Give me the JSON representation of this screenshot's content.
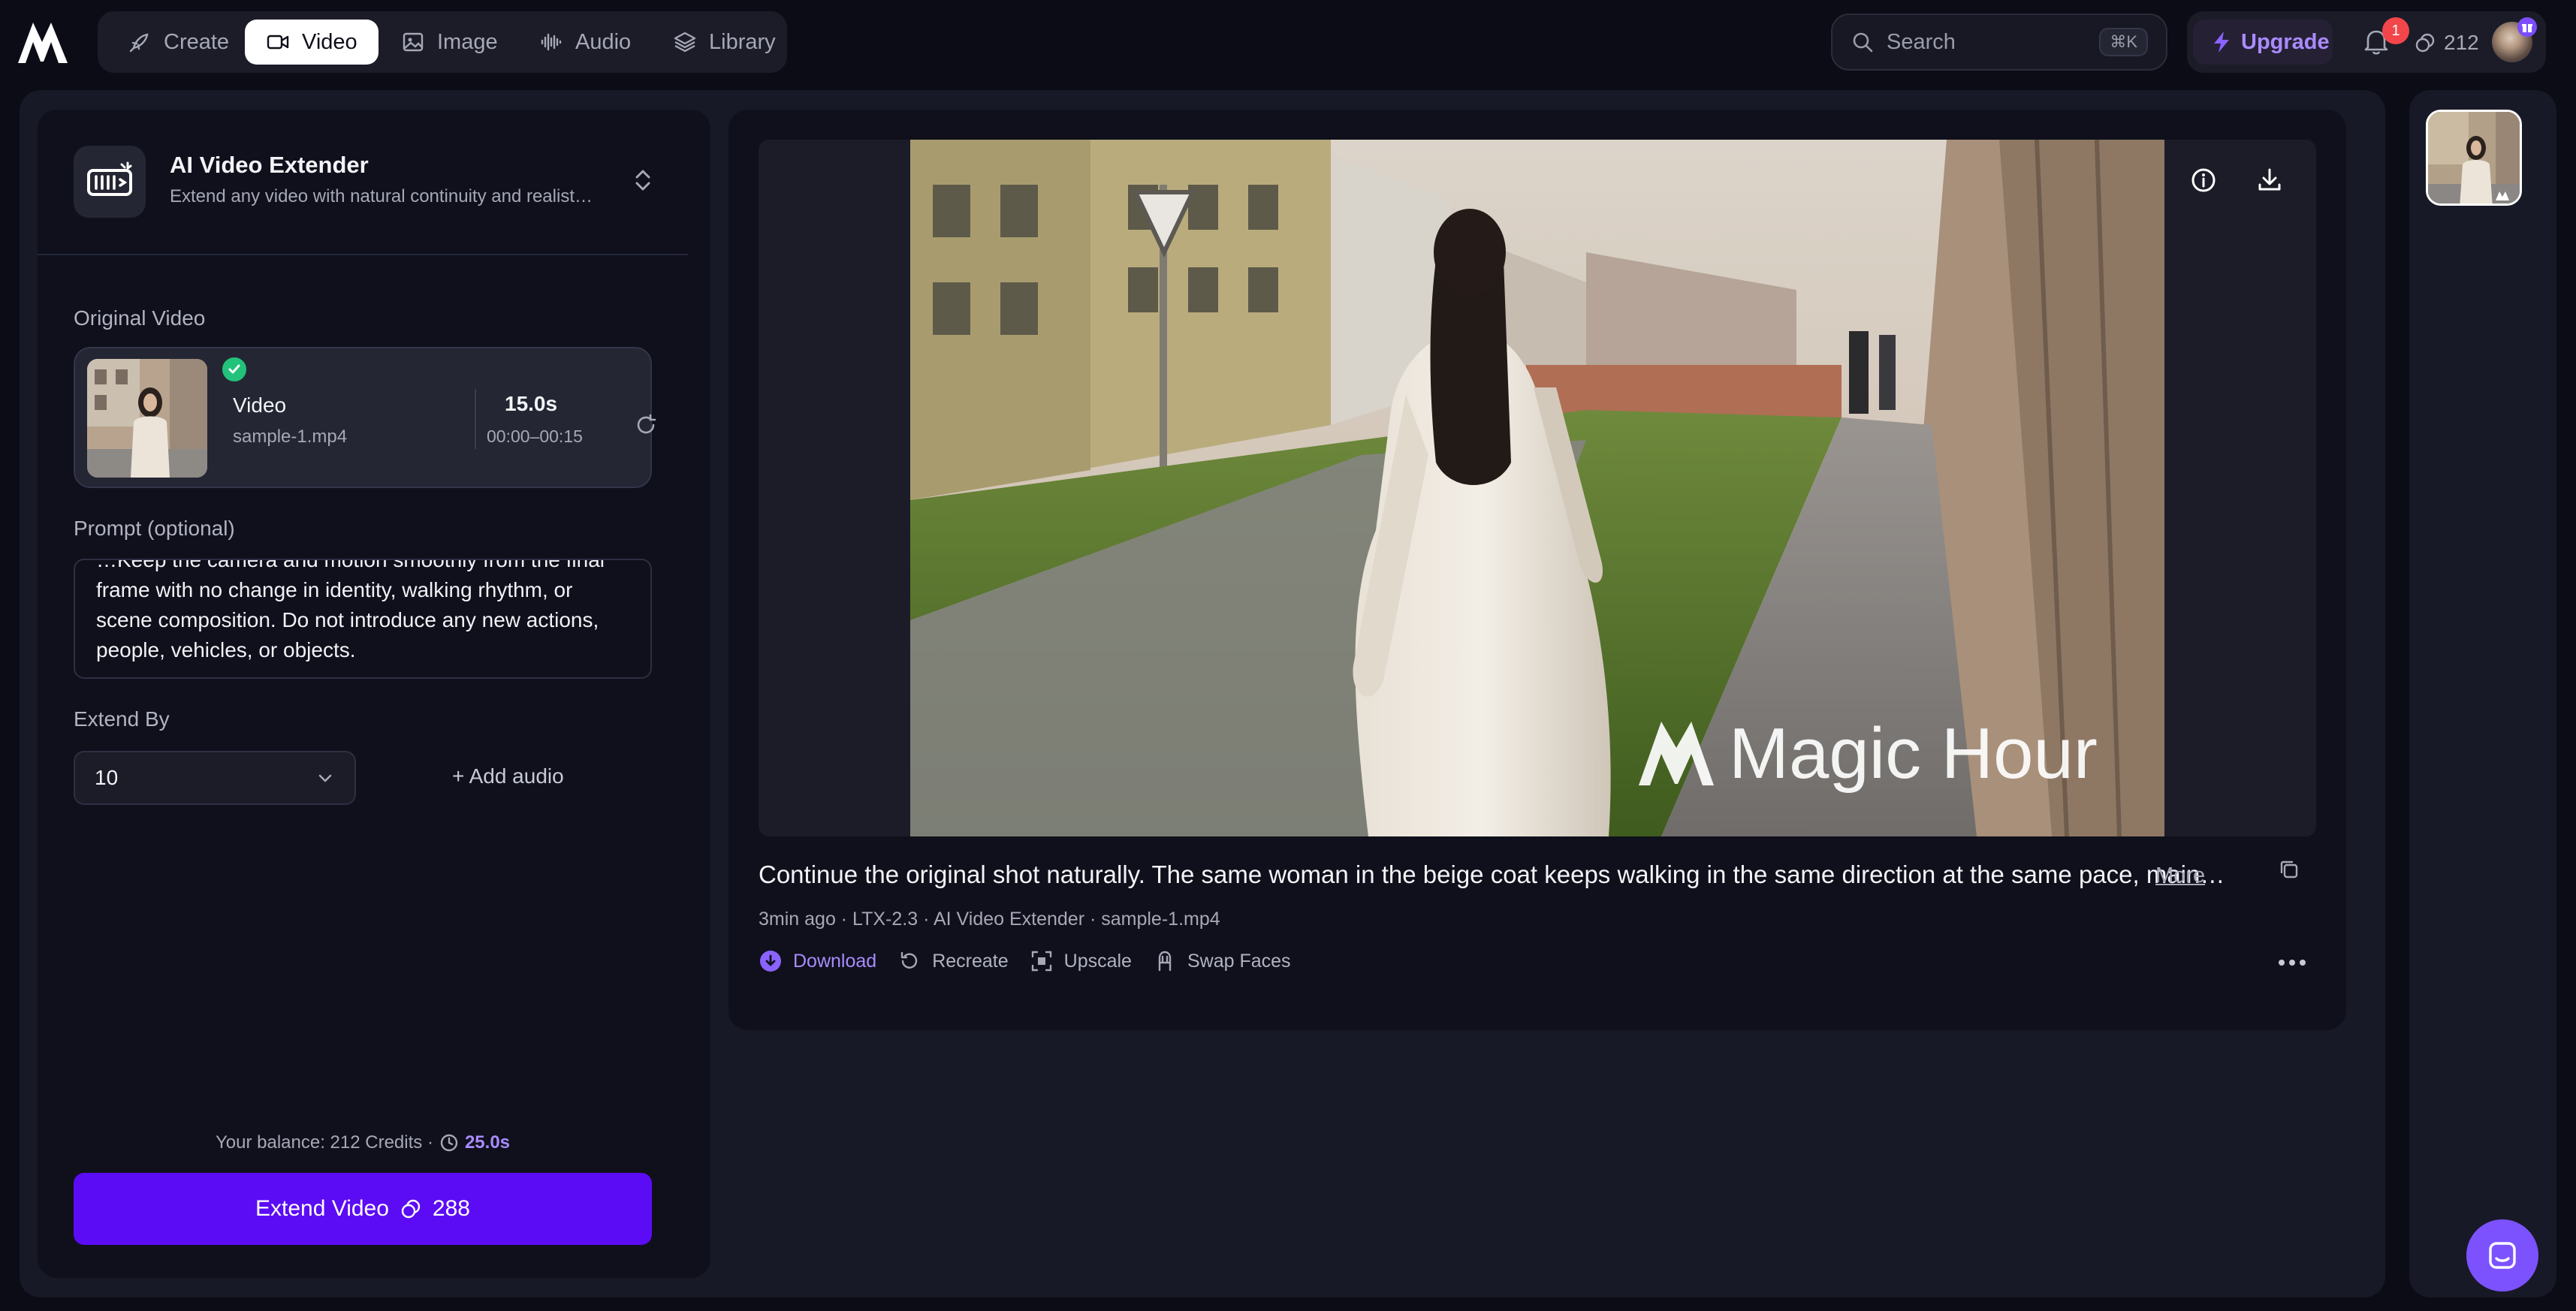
{
  "nav": {
    "items": [
      {
        "label": "Create",
        "icon": "rocket-icon"
      },
      {
        "label": "Video",
        "icon": "video-icon",
        "active": true
      },
      {
        "label": "Image",
        "icon": "image-icon"
      },
      {
        "label": "Audio",
        "icon": "audio-wave-icon"
      },
      {
        "label": "Library",
        "icon": "layers-icon"
      }
    ],
    "search": {
      "label": "Search",
      "shortcut": "⌘K"
    },
    "upgrade_label": "Upgrade",
    "notifications_count": "1",
    "credits": "212"
  },
  "tool": {
    "title": "AI Video Extender",
    "subtitle": "Extend any video with natural continuity and realist…"
  },
  "original_video": {
    "section_label": "Original Video",
    "name": "Video",
    "file": "sample-1.mp4",
    "duration": "15.0s",
    "range": "00:00–00:15"
  },
  "prompt": {
    "label": "Prompt (optional)",
    "text": "…Keep the camera and motion smoothly from the final frame with no change in identity, walking rhythm, or scene composition. Do not introduce any new actions, people, vehicles, or objects."
  },
  "extend_by": {
    "label": "Extend By",
    "value": "10",
    "add_audio_label": "+ Add audio"
  },
  "balance": {
    "text": "Your balance: 212 Credits ·",
    "seconds": "25.0s"
  },
  "extend_button": {
    "label": "Extend Video",
    "cost": "288"
  },
  "result": {
    "watermark": "Magic Hour",
    "caption": "Continue the original shot naturally. The same woman in the beige coat keeps walking in the same direction at the same pace, main…",
    "more_label": "More",
    "meta": "3min ago · LTX-2.3 · AI Video Extender · sample-1.mp4",
    "actions": {
      "download": "Download",
      "recreate": "Recreate",
      "upscale": "Upscale",
      "swap_faces": "Swap Faces"
    }
  },
  "colors": {
    "accent": "#5b0cf5",
    "accent_text": "#a98bff",
    "success": "#22c27a",
    "badge": "#f2464b",
    "background": "#0b0c16"
  }
}
